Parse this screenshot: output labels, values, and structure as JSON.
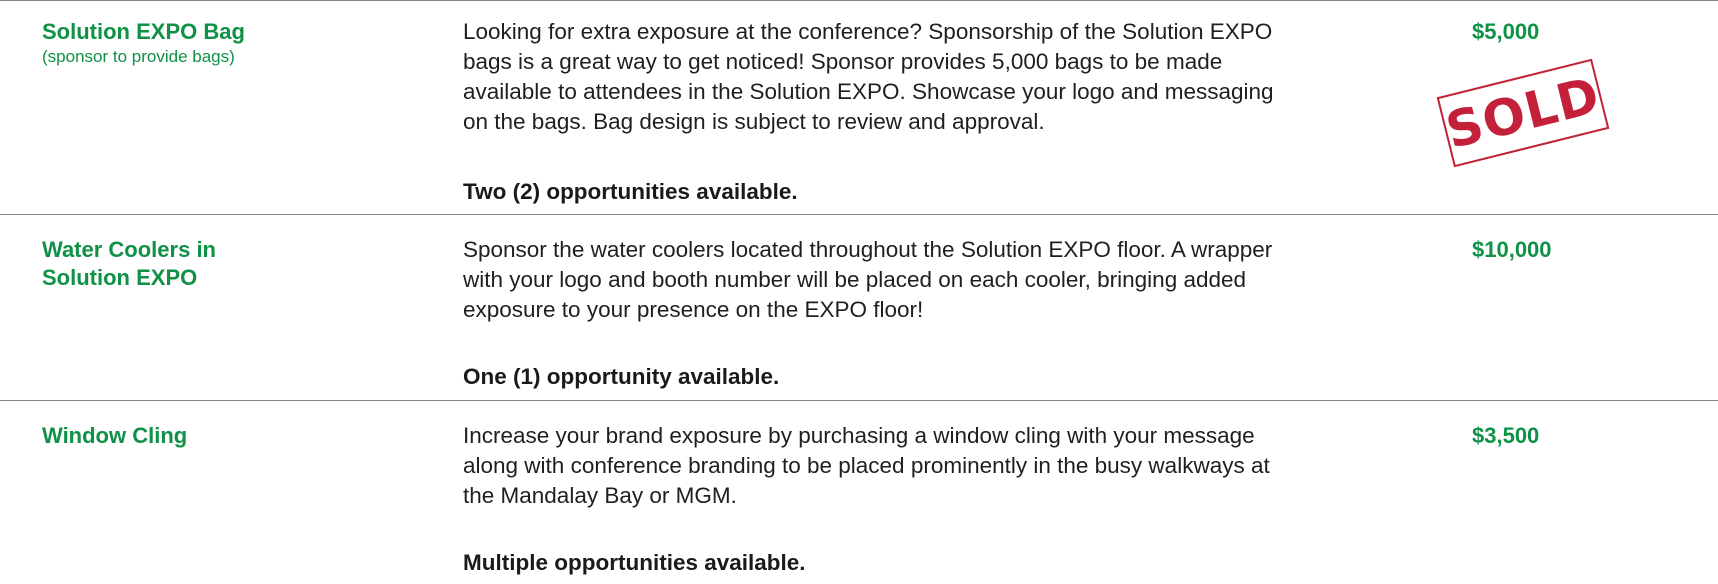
{
  "items": [
    {
      "name": "Solution EXPO Bag",
      "note": "(sponsor to provide bags)",
      "description_lines": [
        "Looking for extra exposure at the conference? Sponsorship of the Solution EXPO",
        "bags is a great way to get noticed! Sponsor provides 5,000 bags to be made",
        "available to attendees in the Solution EXPO. Showcase your logo and messaging",
        "on the bags. Bag design is subject to review and approval."
      ],
      "availability": "Two (2) opportunities available.",
      "price": "$5,000",
      "stamp": "SOLD"
    },
    {
      "name_lines": [
        "Water Coolers in",
        "Solution EXPO"
      ],
      "description_lines": [
        "Sponsor the water coolers located throughout the Solution EXPO floor. A wrapper",
        "with your logo and booth number will be placed on each cooler, bringing added",
        "exposure to your presence on the EXPO floor!"
      ],
      "availability": "One (1) opportunity available.",
      "price": "$10,000"
    },
    {
      "name": "Window Cling",
      "description_lines": [
        "Increase your brand exposure by purchasing a window cling with your message",
        "along with conference branding to be placed prominently in the busy walkways at",
        "the Mandalay Bay or MGM."
      ],
      "availability": "Multiple opportunities available.",
      "price": "$3,500"
    }
  ],
  "colors": {
    "accent_green": "#0f9146",
    "stamp_red": "#c4203a",
    "rule_gray": "#8a8a8a"
  }
}
